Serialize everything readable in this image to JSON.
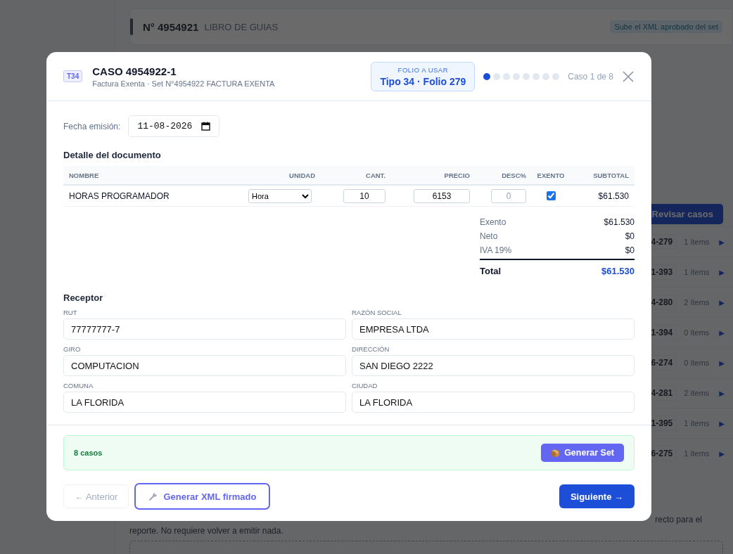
{
  "background": {
    "header": {
      "number": "N° 4954921",
      "title": "LIBRO DE GUIAS",
      "badge": "Sube el XML aprobado del set"
    },
    "review_button": "Revisar casos",
    "cases": [
      {
        "code": "4-279",
        "items": "1 ítems",
        "arrow": "▶"
      },
      {
        "code": "1-393",
        "items": "1 ítems",
        "arrow": "▶"
      },
      {
        "code": "4-280",
        "items": "2 ítems",
        "arrow": "▶"
      },
      {
        "code": "1-394",
        "items": "0 ítems",
        "arrow": "▶"
      },
      {
        "code": "6-274",
        "items": "0 ítems",
        "arrow": "▶"
      },
      {
        "code": "4-281",
        "items": "2 ítems",
        "arrow": "▶"
      },
      {
        "code": "1-395",
        "items": "1 ítems",
        "arrow": "▶"
      },
      {
        "code": "6-275",
        "items": "1 ítems",
        "arrow": "▶"
      }
    ],
    "note_lines": [
      "recto para el",
      "reporte. No requiere volver a emitir nada."
    ]
  },
  "modal": {
    "type_badge": "T34",
    "title": "CASO 4954922-1",
    "subtitle": "Factura Exenta · Set N°4954922 FACTURA EXENTA",
    "folio": {
      "label": "FOLIO A USAR",
      "value": "Tipo 34 · Folio 279"
    },
    "steps": [
      {
        "selected": true
      },
      {
        "selected": false
      },
      {
        "selected": false
      },
      {
        "selected": false
      },
      {
        "selected": false
      },
      {
        "selected": false
      },
      {
        "selected": false
      },
      {
        "selected": false
      }
    ],
    "counter": "Caso 1 de 8",
    "date": {
      "label": "Fecha emisión:",
      "value": "11-08-2026"
    },
    "detail_title": "Detalle del documento",
    "columns": [
      "NOMBRE",
      "UNIDAD",
      "CANT.",
      "PRECIO",
      "DESC%",
      "EXENTO",
      "SUBTOTAL"
    ],
    "rows": [
      {
        "name": "HORAS PROGRAMADOR",
        "unit": "Hora",
        "quantity": "10",
        "price": "6153",
        "discount": "0",
        "exempt": true,
        "subtotal": "$61.530"
      }
    ],
    "totals": [
      {
        "kind": "line",
        "label": "Exento",
        "value": "$61.530"
      },
      {
        "kind": "line",
        "label": "Neto",
        "value": "$0"
      },
      {
        "kind": "line",
        "label": "IVA 19%",
        "value": "$0"
      },
      {
        "kind": "total",
        "label": "Total",
        "value": "$61.530"
      }
    ],
    "receptor_title": "Receptor",
    "fields": [
      {
        "label": "RUT",
        "value": "77777777-7"
      },
      {
        "label": "RAZÓN SOCIAL",
        "value": "EMPRESA LTDA"
      },
      {
        "label": "GIRO",
        "value": "COMPUTACION"
      },
      {
        "label": "DIRECCIÓN",
        "value": "SAN DIEGO 2222"
      },
      {
        "label": "COMUNA",
        "value": "LA FLORIDA"
      },
      {
        "label": "CIUDAD",
        "value": "LA FLORIDA"
      }
    ],
    "summary": {
      "text": "8 casos",
      "button": "Generar Set"
    },
    "footer": {
      "previous": {
        "label": "← Anterior",
        "disabled": true
      },
      "generate": "Generar XML firmado",
      "next": {
        "label": "Siguiente →",
        "disabled": false
      }
    }
  }
}
